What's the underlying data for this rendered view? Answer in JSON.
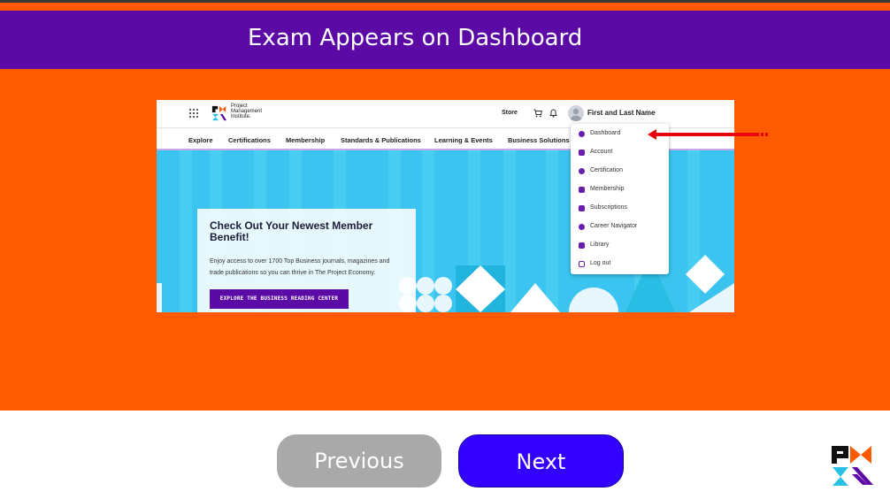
{
  "slide": {
    "title": "Exam Appears on Dashboard"
  },
  "site": {
    "logo_lines": [
      "Project",
      "Management",
      "Institute."
    ],
    "store_label": "Store",
    "user_name": "First and Last Name",
    "nav": [
      "Explore",
      "Certifications",
      "Membership",
      "Standards & Publications",
      "Learning & Events",
      "Business Solutions"
    ],
    "dropdown": [
      "Dashboard",
      "Account",
      "Certification",
      "Membership",
      "Subscriptions",
      "Career Navigator",
      "Library",
      "Log out"
    ],
    "promo": {
      "title": "Check Out Your Newest Member Benefit!",
      "body": "Enjoy access to over 1700 Top Business journals, magazines and trade publications so you can thrive in The Project Economy.",
      "button": "EXPLORE THE BUSINESS READING CENTER"
    }
  },
  "controls": {
    "previous_label": "Previous",
    "next_label": "Next"
  },
  "colors": {
    "stage": "#ff5a00",
    "banner": "#5b0aa6",
    "next_button": "#3300ff",
    "previous_button": "#a9a9a9",
    "hero": "#3ac4ef",
    "arrow": "#e8000b"
  },
  "icons": [
    "grid-icon",
    "cart-icon",
    "bell-icon",
    "avatar-icon",
    "chevron-down-icon",
    "arrow-icon",
    "pmi-logo"
  ]
}
